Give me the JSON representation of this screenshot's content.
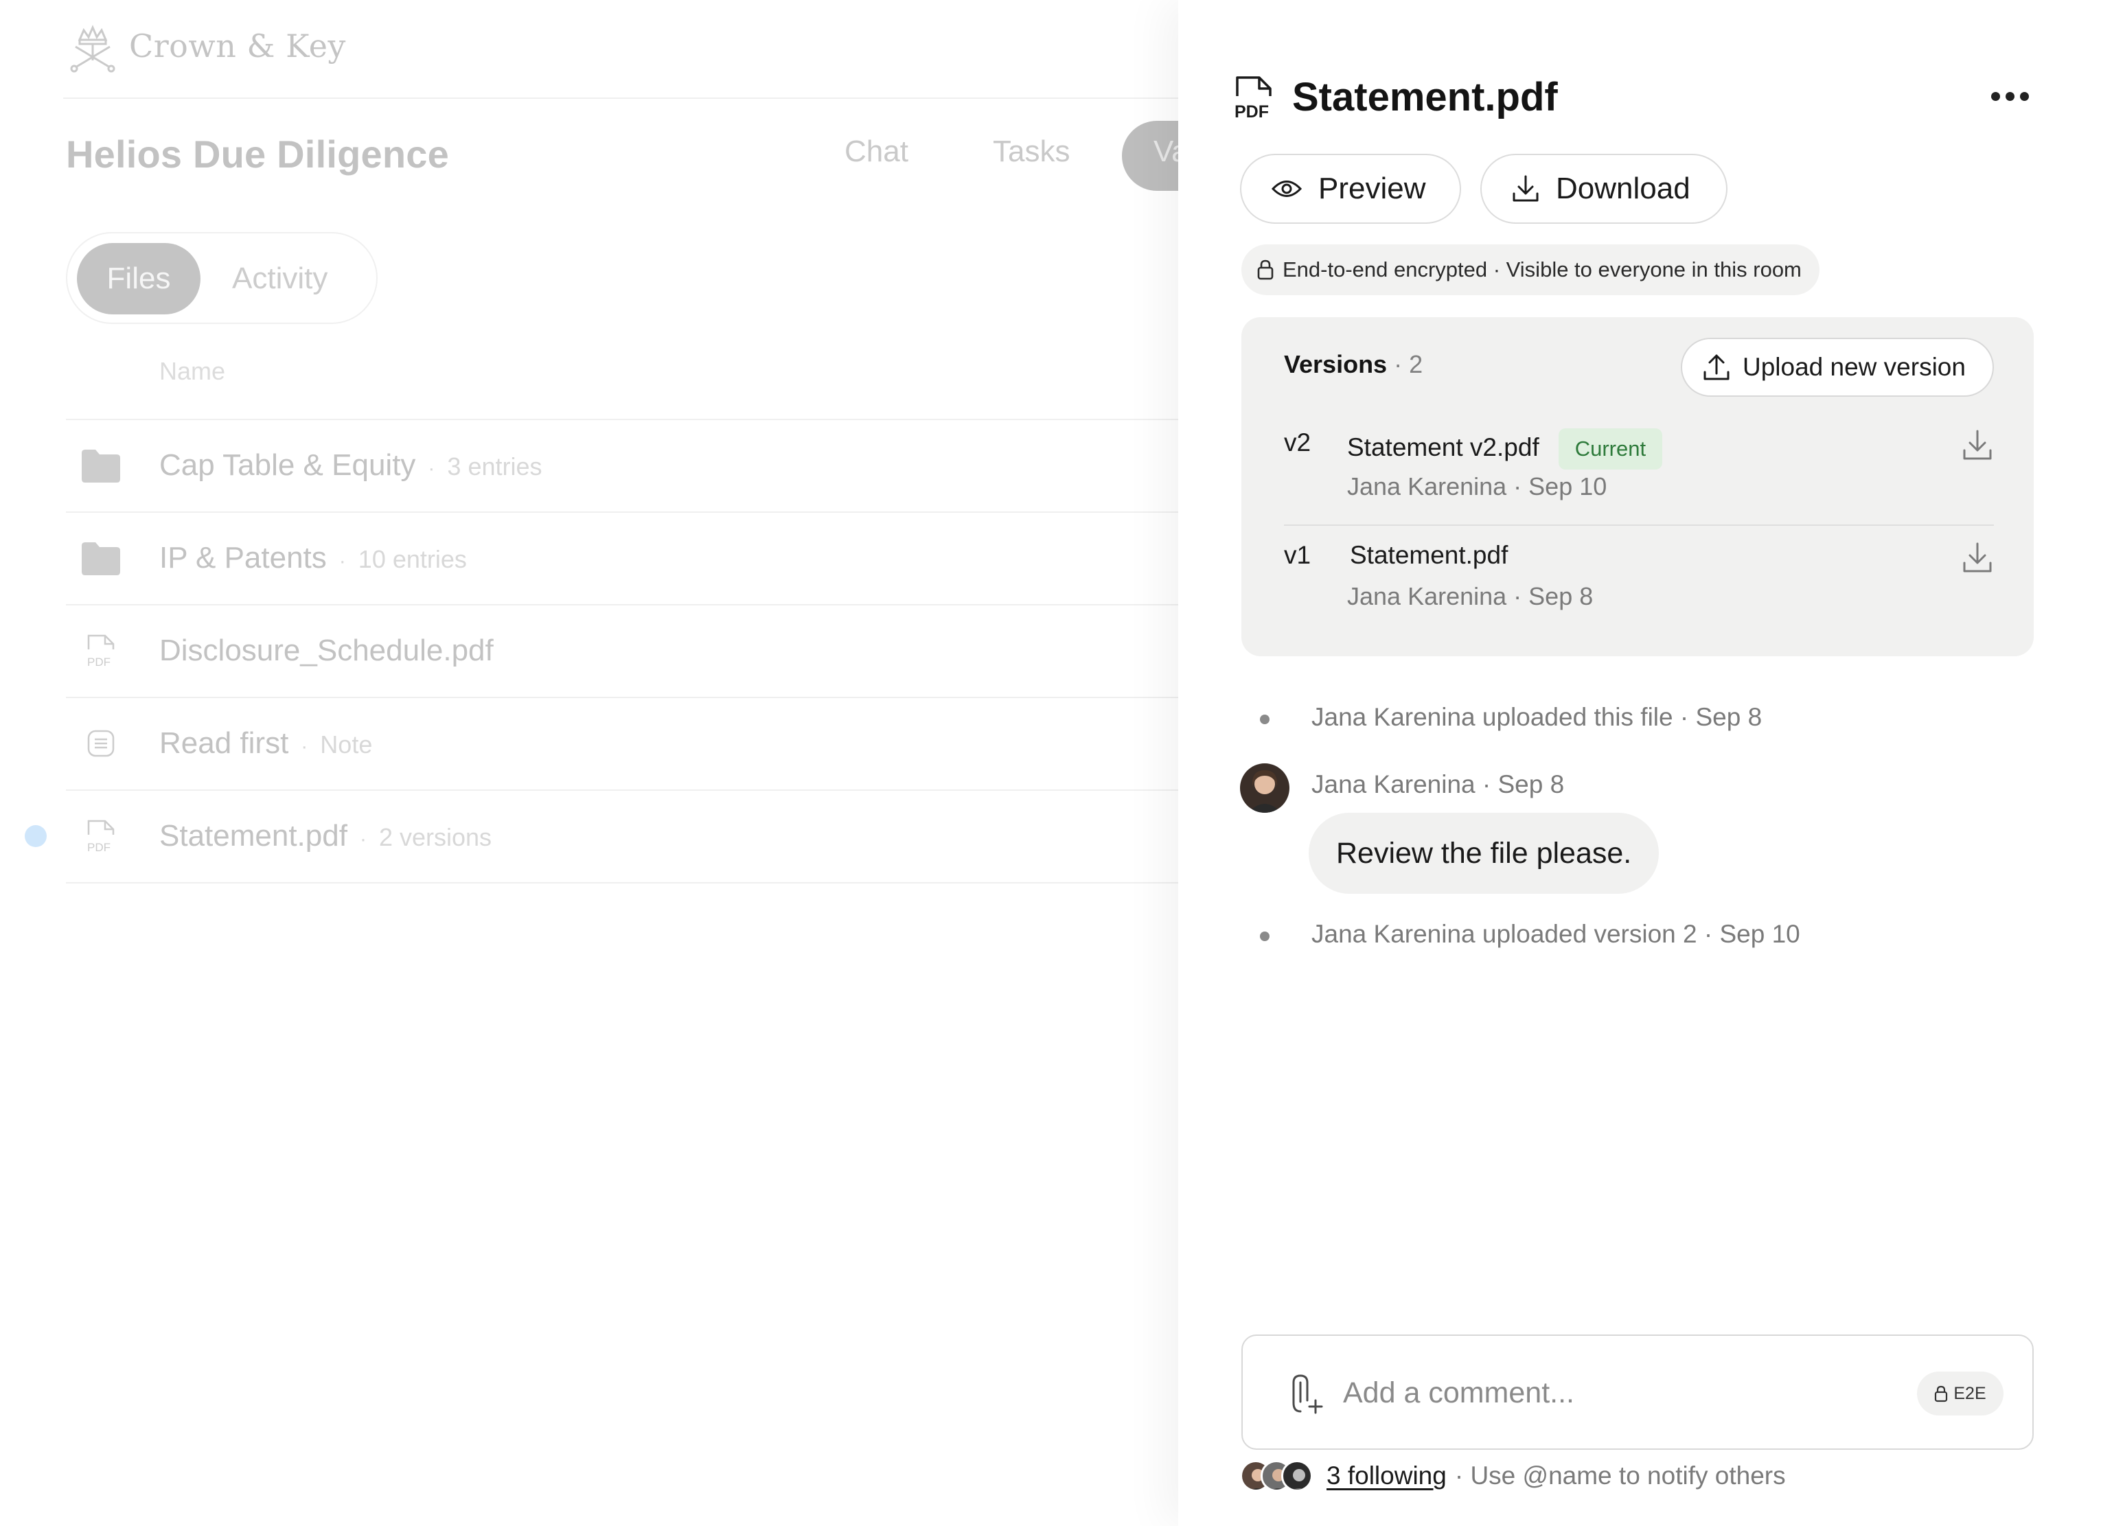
{
  "app": {
    "brand": "Crown & Key",
    "room_title": "Helios Due Diligence",
    "room_tabs": [
      "Chat",
      "Tasks",
      "Va"
    ],
    "view_tabs": {
      "files": "Files",
      "activity": "Activity"
    },
    "column_name": "Name",
    "rows": [
      {
        "name": "Cap Table & Equity",
        "meta": "3 entries",
        "icon": "folder-icon"
      },
      {
        "name": "IP & Patents",
        "meta": "10 entries",
        "icon": "folder-icon"
      },
      {
        "name": "Disclosure_Schedule.pdf",
        "meta": "",
        "icon": "pdf-file-icon"
      },
      {
        "name": "Read first",
        "meta": "Note",
        "icon": "note-icon"
      },
      {
        "name": "Statement.pdf",
        "meta": "2 versions",
        "icon": "pdf-file-icon"
      }
    ]
  },
  "panel": {
    "title": "Statement.pdf",
    "preview_label": "Preview",
    "download_label": "Download",
    "encryption_note": "End-to-end encrypted · Visible to everyone in this room",
    "versions": {
      "title": "Versions",
      "count": " · 2",
      "upload_label": "Upload new version",
      "items": [
        {
          "label": "v2",
          "file": "Statement v2.pdf",
          "badge": "Current",
          "meta": "Jana Karenina · Sep 10"
        },
        {
          "label": "v1",
          "file": "Statement.pdf",
          "badge": "",
          "meta": "Jana Karenina · Sep 8"
        }
      ]
    },
    "activity": {
      "upload_event": "Jana Karenina uploaded this file · Sep 8",
      "comment_meta": "Jana Karenina · Sep 8",
      "comment_text": "Review the file please.",
      "version_event": "Jana Karenina uploaded version 2 · Sep 10"
    },
    "composer": {
      "placeholder": "Add a comment...",
      "e2e_label": "E2E"
    },
    "following": {
      "link": "3 following",
      "hint": "· Use @name to notify others"
    }
  },
  "colors": {
    "accent_green_bg": "#dff0df",
    "accent_green_text": "#2d7a3a",
    "unread_dot": "#cfe6fb",
    "surface": "#f1f1f0"
  }
}
